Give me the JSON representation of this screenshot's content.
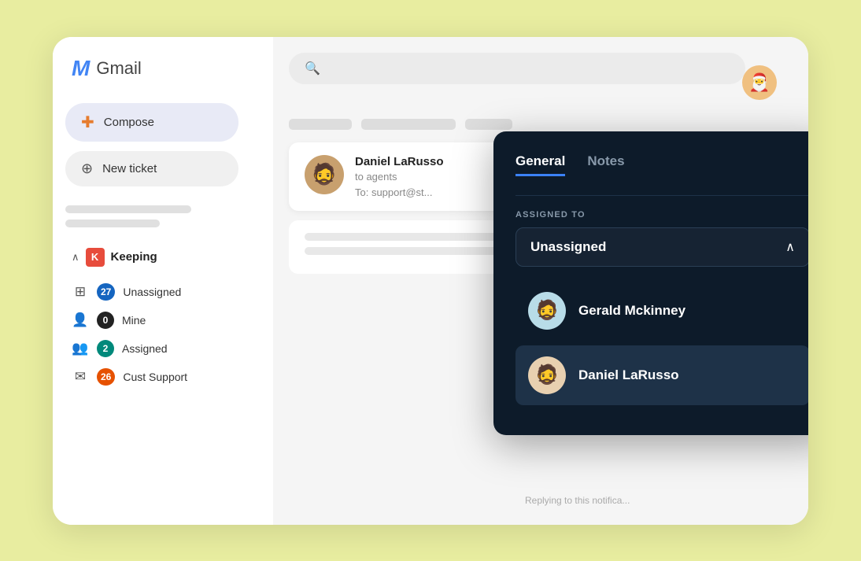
{
  "app": {
    "background": "#e8eda0"
  },
  "gmail": {
    "logo_m": "M",
    "logo_label": "Gmail"
  },
  "sidebar": {
    "compose_label": "Compose",
    "new_ticket_label": "New ticket",
    "keeping_title": "Keeping",
    "nav_items": [
      {
        "id": "unassigned",
        "label": "Unassigned",
        "badge": "27",
        "badge_class": "badge-blue"
      },
      {
        "id": "mine",
        "label": "Mine",
        "badge": "0",
        "badge_class": "badge-dark"
      },
      {
        "id": "assigned",
        "label": "Assigned",
        "badge": "2",
        "badge_class": "badge-teal"
      },
      {
        "id": "cust",
        "label": "Cust Support",
        "badge": "26",
        "badge_class": "badge-orange"
      }
    ]
  },
  "search": {
    "placeholder": "Search"
  },
  "email": {
    "sender": "Daniel LaRusso",
    "subtitle": "to agents",
    "to_label": "To: support@st..."
  },
  "reply_text": "Replying to this notifica...",
  "panel": {
    "tab_general": "General",
    "tab_notes": "Notes",
    "assigned_to_label": "ASSIGNED TO",
    "dropdown_value": "Unassigned",
    "agents": [
      {
        "id": "gerald",
        "name": "Gerald Mckinney",
        "avatar_class": "gerald",
        "emoji": "🧔"
      },
      {
        "id": "daniel",
        "name": "Daniel LaRusso",
        "avatar_class": "daniel",
        "emoji": "🧔"
      }
    ]
  }
}
